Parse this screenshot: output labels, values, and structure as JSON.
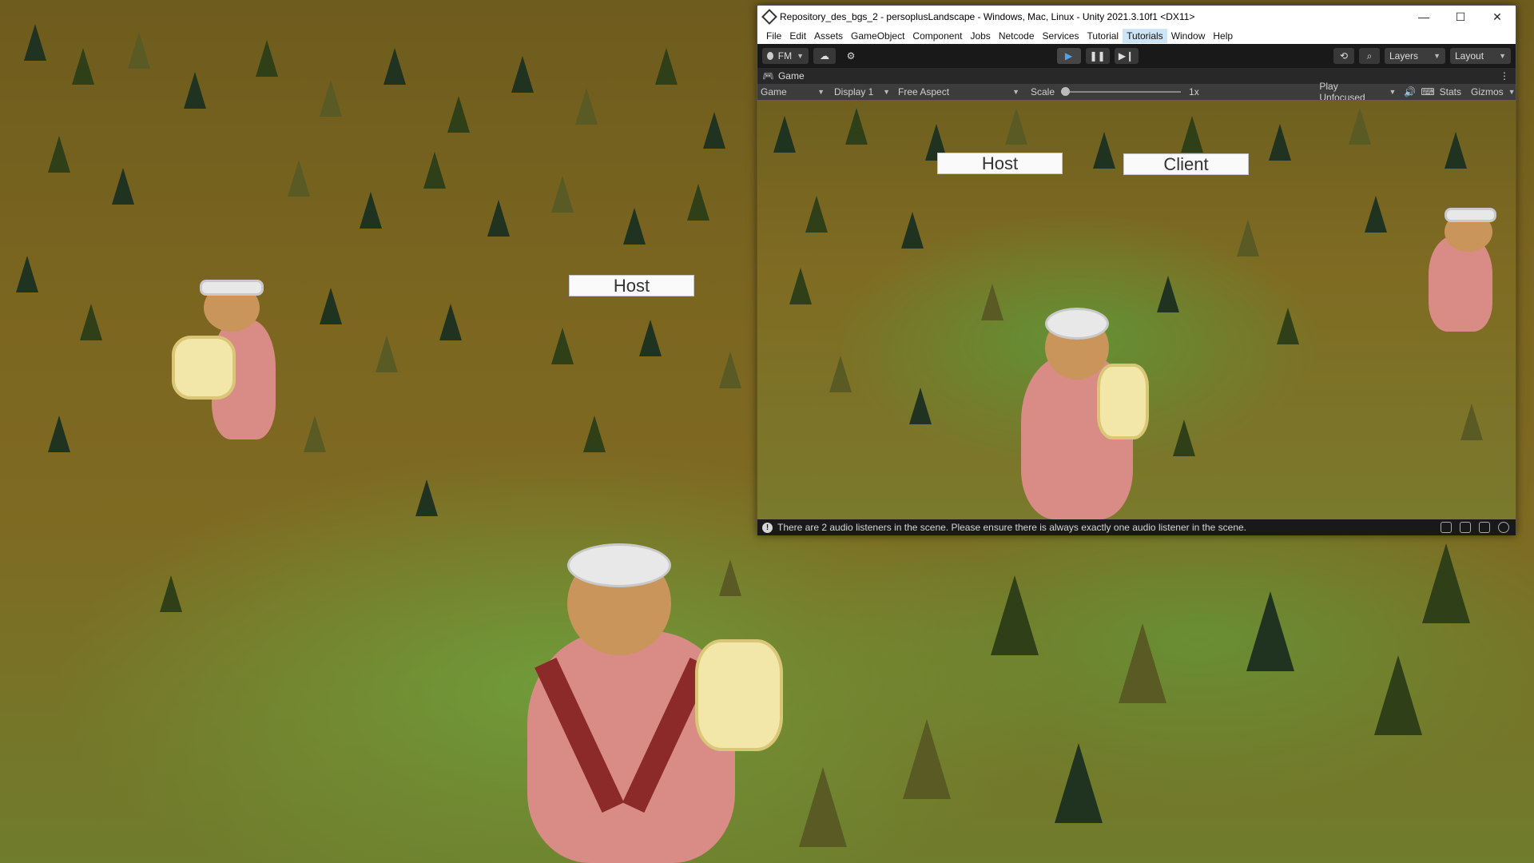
{
  "background_game": {
    "host_button_label": "Host"
  },
  "window": {
    "title": "Repository_des_bgs_2 - persoplusLandscape - Windows, Mac, Linux - Unity 2021.3.10f1 <DX11>",
    "minimize": "—",
    "maximize": "☐",
    "close": "✕"
  },
  "menu": [
    "File",
    "Edit",
    "Assets",
    "GameObject",
    "Component",
    "Jobs",
    "Netcode",
    "Services",
    "Tutorial",
    "Tutorials",
    "Window",
    "Help"
  ],
  "toolbar": {
    "account_label": "FM",
    "layers_label": "Layers",
    "layout_label": "Layout"
  },
  "game_tab": {
    "label": "Game"
  },
  "game_controls": {
    "view_mode": "Game",
    "display": "Display 1",
    "aspect": "Free Aspect",
    "scale_label": "Scale",
    "scale_value": "1x",
    "play_mode": "Play Unfocused",
    "stats": "Stats",
    "gizmos": "Gizmos"
  },
  "game_view": {
    "host_button_label": "Host",
    "client_button_label": "Client"
  },
  "status": {
    "message": "There are 2 audio listeners in the scene. Please ensure there is always exactly one audio listener in the scene."
  }
}
